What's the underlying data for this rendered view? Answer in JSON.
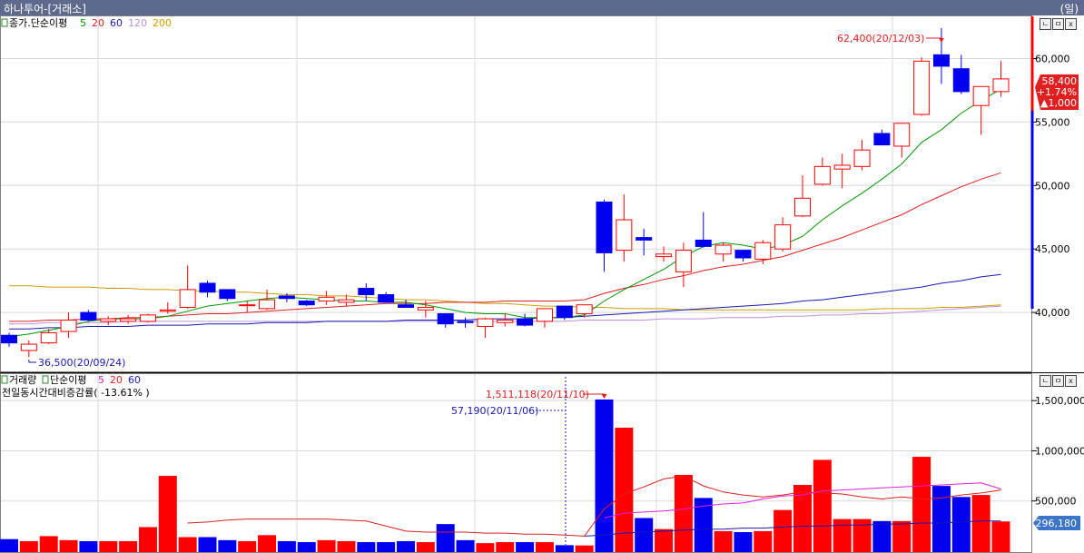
{
  "window": {
    "title": "하나투어-[거래소]",
    "period": "(일)"
  },
  "price_panel": {
    "legend_prefix": "종가.단순이평",
    "ma": [
      {
        "label": "5",
        "color": "#009900"
      },
      {
        "label": "20",
        "color": "#e02020"
      },
      {
        "label": "60",
        "color": "#1a1ab0"
      },
      {
        "label": "120",
        "color": "#c090e0"
      },
      {
        "label": "200",
        "color": "#d0a000"
      }
    ],
    "current": {
      "price": "58,400",
      "change_pct": "+1.74%",
      "change": "▲1,000"
    },
    "high_label": "62,400(20/12/03)",
    "low_label": "36,500(20/09/24)"
  },
  "volume_panel": {
    "legend_prefix": "거래량",
    "legend_ma_prefix": "단순이평",
    "ma": [
      {
        "label": "5",
        "color": "#e020a0"
      },
      {
        "label": "20",
        "color": "#e02020"
      },
      {
        "label": "60",
        "color": "#1a1ab0"
      }
    ],
    "subtitle": "전일동시간대비증감률( -13.61% )",
    "max_label": "1,511,118(20/11/10)",
    "min_label": "57,190(20/11/06)",
    "current_label": "296,180"
  },
  "panel_buttons": [
    "ㄴ",
    "ㅁ",
    "x"
  ],
  "colors": {
    "up": "#ff0000",
    "down": "#0000ee",
    "ma5": "#009900",
    "ma20": "#e02020",
    "ma60": "#1a1ab0",
    "ma120": "#c090e0",
    "ma200": "#d0a000"
  },
  "chart_data": [
    {
      "type": "candlestick",
      "yticks": [
        40000,
        45000,
        50000,
        55000,
        60000
      ],
      "ytick_labels": [
        "40,000",
        "45,000",
        "50,000",
        "55,000",
        "60,000"
      ],
      "ylim": [
        36000,
        63400
      ],
      "candles": [
        [
          38200,
          38400,
          37300,
          37600
        ],
        [
          37000,
          37800,
          36500,
          37500
        ],
        [
          37600,
          38700,
          37500,
          38400
        ],
        [
          38500,
          40000,
          38000,
          39400
        ],
        [
          40000,
          40200,
          39300,
          39400
        ],
        [
          39300,
          39700,
          39000,
          39500
        ],
        [
          39300,
          39800,
          39100,
          39500
        ],
        [
          39300,
          39900,
          39200,
          39800
        ],
        [
          40100,
          40800,
          39900,
          40200
        ],
        [
          40400,
          43700,
          40300,
          41800
        ],
        [
          42300,
          42500,
          41200,
          41600
        ],
        [
          41800,
          41800,
          40900,
          41100
        ],
        [
          40600,
          40900,
          40000,
          40600
        ],
        [
          40300,
          41800,
          40200,
          41000
        ],
        [
          41300,
          41500,
          40800,
          41100
        ],
        [
          40900,
          41000,
          40500,
          40600
        ],
        [
          40900,
          41700,
          40600,
          41200
        ],
        [
          40800,
          41400,
          40500,
          41000
        ],
        [
          41900,
          42300,
          40900,
          41400
        ],
        [
          41400,
          41600,
          40800,
          40800
        ],
        [
          40600,
          41000,
          40400,
          40400
        ],
        [
          40200,
          40900,
          39600,
          40400
        ],
        [
          39900,
          39900,
          38800,
          39100
        ],
        [
          39300,
          39600,
          38800,
          39200
        ],
        [
          38900,
          39600,
          38000,
          39500
        ],
        [
          39200,
          39900,
          38900,
          39400
        ],
        [
          39500,
          39900,
          38900,
          39000
        ],
        [
          39300,
          40300,
          38800,
          40300
        ],
        [
          40500,
          40500,
          39400,
          39600
        ],
        [
          39900,
          40600,
          39600,
          40600
        ],
        [
          48700,
          48900,
          43200,
          44700
        ],
        [
          44900,
          49300,
          44000,
          47300
        ],
        [
          45900,
          46600,
          44500,
          45700
        ],
        [
          44400,
          45200,
          44000,
          44600
        ],
        [
          43200,
          45500,
          42000,
          44900
        ],
        [
          45700,
          47900,
          45100,
          45200
        ],
        [
          44600,
          45500,
          44000,
          45300
        ],
        [
          44900,
          44900,
          44000,
          44300
        ],
        [
          44200,
          45700,
          43800,
          45500
        ],
        [
          45000,
          47500,
          44800,
          46900
        ],
        [
          47600,
          50800,
          47500,
          49000
        ],
        [
          50100,
          52200,
          50000,
          51500
        ],
        [
          51300,
          52500,
          49800,
          51600
        ],
        [
          51500,
          53600,
          51200,
          52800
        ],
        [
          54100,
          54400,
          53200,
          53200
        ],
        [
          53100,
          54800,
          52200,
          54900
        ],
        [
          55600,
          60100,
          55500,
          59800
        ],
        [
          60300,
          62400,
          58000,
          59400
        ],
        [
          59200,
          60300,
          57200,
          57400
        ],
        [
          56300,
          57700,
          54000,
          57800
        ],
        [
          57400,
          59800,
          57000,
          58400
        ]
      ],
      "ma5": [
        38100,
        38300,
        38600,
        38900,
        39300,
        39500,
        39500,
        39500,
        39700,
        40100,
        40500,
        40700,
        40900,
        41100,
        41200,
        41100,
        41000,
        40900,
        40900,
        40800,
        40800,
        40600,
        40300,
        40000,
        39900,
        39900,
        39600,
        39600,
        39600,
        39800,
        40900,
        41800,
        42600,
        43400,
        44400,
        45200,
        45500,
        45300,
        45000,
        45300,
        46000,
        47300,
        48400,
        49400,
        50500,
        51700,
        53400,
        54400,
        55700,
        56700,
        57600
      ],
      "ma20": [
        39300,
        39300,
        39400,
        39400,
        39500,
        39500,
        39600,
        39600,
        39700,
        39800,
        39900,
        39900,
        40000,
        40100,
        40200,
        40300,
        40400,
        40500,
        40600,
        40700,
        40700,
        40700,
        40800,
        40800,
        40800,
        40900,
        40900,
        40900,
        40900,
        41000,
        41500,
        41900,
        42200,
        42600,
        42900,
        43300,
        43600,
        43800,
        44100,
        44400,
        44900,
        45400,
        45900,
        46500,
        47100,
        47700,
        48500,
        49200,
        49900,
        50500,
        51000
      ],
      "ma60": [
        38700,
        38700,
        38800,
        38800,
        38900,
        38900,
        38900,
        39000,
        39000,
        39000,
        39100,
        39100,
        39100,
        39200,
        39200,
        39200,
        39300,
        39300,
        39300,
        39300,
        39400,
        39400,
        39400,
        39400,
        39500,
        39500,
        39500,
        39600,
        39600,
        39700,
        39800,
        39900,
        40000,
        40100,
        40200,
        40300,
        40400,
        40500,
        40600,
        40700,
        40900,
        41000,
        41200,
        41400,
        41600,
        41800,
        42000,
        42300,
        42500,
        42800,
        43000
      ],
      "ma120": [
        39100,
        39100,
        39200,
        39200,
        39200,
        39200,
        39300,
        39300,
        39300,
        39300,
        39300,
        39300,
        39300,
        39300,
        39300,
        39300,
        39300,
        39300,
        39300,
        39300,
        39300,
        39300,
        39300,
        39300,
        39300,
        39300,
        39300,
        39300,
        39300,
        39400,
        39400,
        39400,
        39400,
        39500,
        39500,
        39500,
        39600,
        39600,
        39600,
        39700,
        39700,
        39800,
        39800,
        39900,
        39900,
        40000,
        40100,
        40200,
        40300,
        40400,
        40500
      ],
      "ma200": [
        42100,
        42100,
        42000,
        42000,
        42000,
        41900,
        41900,
        41800,
        41800,
        41700,
        41700,
        41600,
        41600,
        41500,
        41400,
        41400,
        41300,
        41300,
        41200,
        41100,
        41000,
        41000,
        40900,
        40800,
        40700,
        40700,
        40600,
        40500,
        40500,
        40400,
        40400,
        40300,
        40300,
        40300,
        40200,
        40200,
        40200,
        40200,
        40200,
        40200,
        40200,
        40200,
        40200,
        40200,
        40300,
        40300,
        40300,
        40400,
        40400,
        40500,
        40600
      ]
    },
    {
      "type": "bar",
      "yticks": [
        500000,
        1000000,
        1500000
      ],
      "ytick_labels": [
        "500,000",
        "1,000,000",
        "1,500,000"
      ],
      "ylim": [
        0,
        1610000
      ],
      "volumes": [
        120000,
        100000,
        150000,
        110000,
        100000,
        100000,
        100000,
        240000,
        750000,
        140000,
        140000,
        110000,
        100000,
        160000,
        100000,
        90000,
        110000,
        100000,
        90000,
        90000,
        100000,
        90000,
        270000,
        110000,
        80000,
        90000,
        90000,
        90000,
        60000,
        57190,
        1511118,
        1230000,
        330000,
        220000,
        760000,
        530000,
        200000,
        190000,
        200000,
        410000,
        660000,
        910000,
        320000,
        320000,
        300000,
        300000,
        940000,
        650000,
        540000,
        560000,
        296180
      ],
      "ma5": [
        null,
        null,
        null,
        null,
        null,
        null,
        null,
        null,
        null,
        null,
        null,
        null,
        null,
        null,
        null,
        null,
        null,
        null,
        null,
        null,
        null,
        null,
        null,
        null,
        null,
        null,
        null,
        null,
        null,
        null,
        330000,
        380000,
        390000,
        400000,
        420000,
        450000,
        470000,
        480000,
        520000,
        550000,
        560000,
        600000,
        610000,
        620000,
        630000,
        640000,
        650000,
        660000,
        670000,
        680000,
        620000
      ],
      "ma20": [
        null,
        null,
        null,
        null,
        null,
        null,
        null,
        null,
        null,
        280000,
        290000,
        310000,
        320000,
        320000,
        320000,
        320000,
        320000,
        310000,
        300000,
        250000,
        200000,
        190000,
        190000,
        190000,
        180000,
        180000,
        170000,
        170000,
        160000,
        150000,
        420000,
        570000,
        640000,
        720000,
        750000,
        650000,
        590000,
        560000,
        540000,
        560000,
        590000,
        580000,
        570000,
        540000,
        520000,
        540000,
        520000,
        530000,
        560000,
        580000,
        610000
      ],
      "ma60": [
        null,
        null,
        null,
        null,
        null,
        null,
        null,
        null,
        null,
        null,
        null,
        null,
        null,
        null,
        null,
        null,
        null,
        null,
        null,
        null,
        null,
        null,
        null,
        null,
        null,
        null,
        null,
        null,
        null,
        150000,
        160000,
        180000,
        190000,
        200000,
        210000,
        220000,
        220000,
        230000,
        230000,
        240000,
        250000,
        250000,
        260000,
        260000,
        270000,
        270000,
        280000,
        280000,
        290000,
        300000,
        300000
      ]
    }
  ]
}
